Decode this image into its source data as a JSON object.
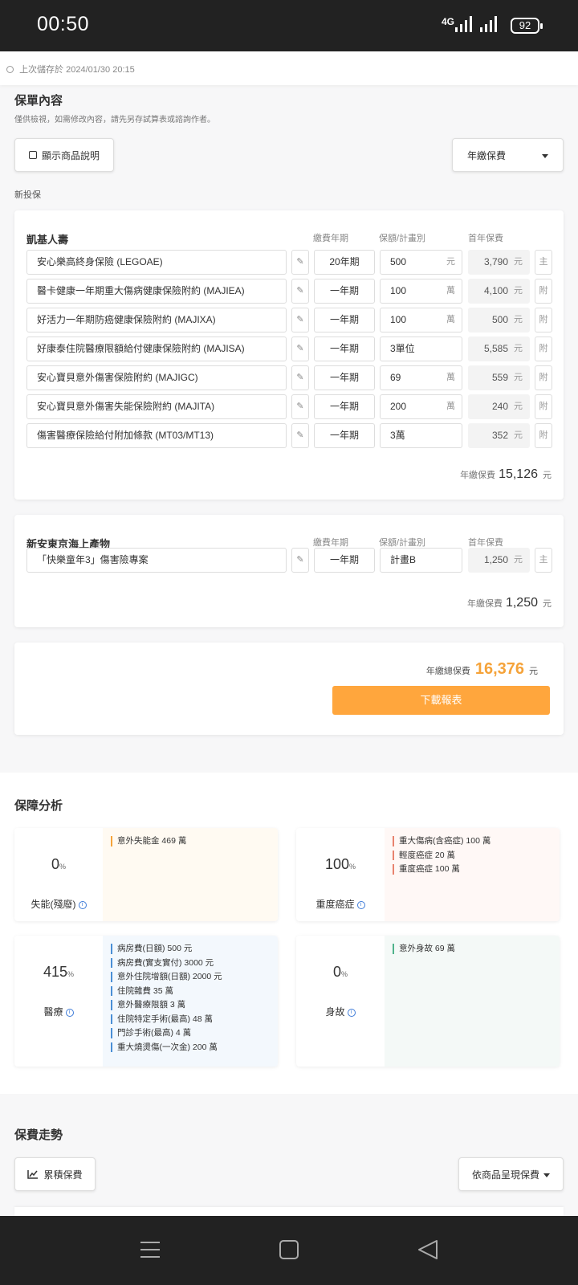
{
  "status": {
    "time": "00:50",
    "network": "4G",
    "battery": "92"
  },
  "save_status": "上次儲存於 2024/01/30 20:15",
  "policy": {
    "title": "保單內容",
    "subtitle": "僅供檢視，如需修改內容，請先另存試算表或諮詢作者。",
    "show_desc_label": "顯示商品說明",
    "pay_mode": "年繳保費",
    "new_label": "新投保"
  },
  "insurers": [
    {
      "name": "凱基人壽",
      "col_term": "繳費年期",
      "col_amount": "保額/計畫別",
      "col_premium": "首年保費",
      "rows": [
        {
          "name": "安心樂高終身保險 (LEGOAE)",
          "term": "20年期",
          "amount": "500",
          "unit": "元",
          "premium": "3,790",
          "premium_unit": "元",
          "type": "主"
        },
        {
          "name": "醫卡健康一年期重大傷病健康保險附約 (MAJIEA)",
          "term": "一年期",
          "amount": "100",
          "unit": "萬",
          "premium": "4,100",
          "premium_unit": "元",
          "type": "附"
        },
        {
          "name": "好活力一年期防癌健康保險附約 (MAJIXA)",
          "term": "一年期",
          "amount": "100",
          "unit": "萬",
          "premium": "500",
          "premium_unit": "元",
          "type": "附"
        },
        {
          "name": "好康泰住院醫療限額給付健康保險附約 (MAJISA)",
          "term": "一年期",
          "amount": "3單位",
          "unit": "",
          "premium": "5,585",
          "premium_unit": "元",
          "type": "附"
        },
        {
          "name": "安心寶貝意外傷害保險附約 (MAJIGC)",
          "term": "一年期",
          "amount": "69",
          "unit": "萬",
          "premium": "559",
          "premium_unit": "元",
          "type": "附"
        },
        {
          "name": "安心寶貝意外傷害失能保險附約 (MAJITA)",
          "term": "一年期",
          "amount": "200",
          "unit": "萬",
          "premium": "240",
          "premium_unit": "元",
          "type": "附"
        },
        {
          "name": "傷害醫療保險給付附加條款 (MT03/MT13)",
          "term": "一年期",
          "amount": "3萬",
          "unit": "",
          "premium": "352",
          "premium_unit": "元",
          "type": "附"
        }
      ],
      "annual_label": "年繳保費",
      "annual_value": "15,126",
      "annual_unit": "元"
    },
    {
      "name": "新安東京海上產物",
      "col_term": "繳費年期",
      "col_amount": "保額/計畫別",
      "col_premium": "首年保費",
      "rows": [
        {
          "name": "「快樂童年3」傷害險專案",
          "term": "一年期",
          "amount": "計畫B",
          "unit": "",
          "premium": "1,250",
          "premium_unit": "元",
          "type": "主"
        }
      ],
      "annual_label": "年繳保費",
      "annual_value": "1,250",
      "annual_unit": "元"
    }
  ],
  "total": {
    "label": "年繳總保費",
    "value": "16,376",
    "unit": "元",
    "download": "下載報表"
  },
  "analysis": {
    "title": "保障分析",
    "cards": [
      {
        "pct": "0",
        "pct_unit": "%",
        "label": "失能(殘廢)",
        "bg": "#fffaf2",
        "bar": "#f5a33a",
        "items": [
          "意外失能金 469 萬"
        ]
      },
      {
        "pct": "100",
        "pct_unit": "%",
        "label": "重度癌症",
        "bg": "#fff8f6",
        "bar": "#e8836f",
        "items": [
          "重大傷病(含癌症) 100 萬",
          "輕度癌症 20 萬",
          "重度癌症 100 萬"
        ]
      },
      {
        "pct": "415",
        "pct_unit": "%",
        "label": "醫療",
        "bg": "#f3f8fd",
        "bar": "#4a8fd6",
        "items": [
          "病房費(日額) 500 元",
          "病房費(實支實付) 3000 元",
          "意外住院增額(日額) 2000 元",
          "住院雜費 35 萬",
          "意外醫療限額 3 萬",
          "住院特定手術(最高) 48 萬",
          "門診手術(最高) 4 萬",
          "重大燒燙傷(一次金) 200 萬"
        ]
      },
      {
        "pct": "0",
        "pct_unit": "%",
        "label": "身故",
        "bg": "#f4f9f7",
        "bar": "#4fb38b",
        "items": [
          "意外身故 69 萬"
        ]
      }
    ]
  },
  "trend": {
    "title": "保費走勢",
    "cumulative_label": "累積保費",
    "by_product_label": "依商品呈現保費"
  }
}
